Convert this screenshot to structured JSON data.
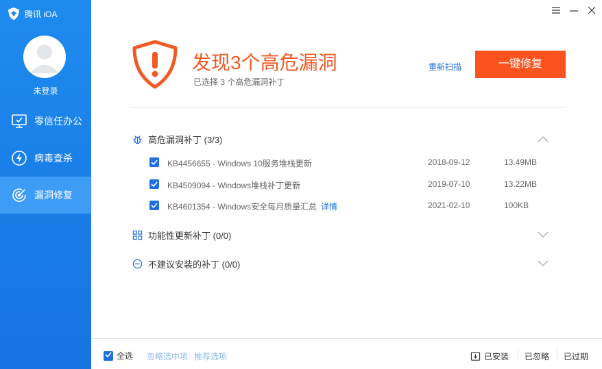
{
  "app": {
    "title": "腾讯 iOA"
  },
  "user": {
    "name": "未登录"
  },
  "sidebar": {
    "items": [
      {
        "label": "零信任办公",
        "icon": "monitor-check-icon",
        "active": false
      },
      {
        "label": "病毒查杀",
        "icon": "lightning-icon",
        "active": false
      },
      {
        "label": "漏洞修复",
        "icon": "radar-icon",
        "active": true
      }
    ]
  },
  "header": {
    "headline": "发现3个高危漏洞",
    "subline": "已选择 3 个高危漏洞补丁",
    "rescan_label": "重新扫描",
    "fix_label": "一键修复"
  },
  "groups": [
    {
      "label": "高危漏洞补丁 (3/3)",
      "icon": "bug-icon",
      "expanded": true,
      "patches": [
        {
          "name": "KB4456655 - Windows 10服务堆栈更新",
          "detail": "",
          "date": "2018-09-12",
          "size": "13.49MB",
          "checked": true
        },
        {
          "name": "KB4509094 - Windows堆栈补丁更新",
          "detail": "",
          "date": "2019-07-10",
          "size": "13.22MB",
          "checked": true
        },
        {
          "name": "KB4601354 - Windows安全每月质量汇总",
          "detail": "详情",
          "date": "2021-02-10",
          "size": "100KB",
          "checked": true
        }
      ]
    },
    {
      "label": "功能性更新补丁 (0/0)",
      "icon": "grid-icon",
      "expanded": false
    },
    {
      "label": "不建议安装的补丁 (0/0)",
      "icon": "minus-circle-icon",
      "expanded": false
    }
  ],
  "footer": {
    "select_all_label": "全选",
    "ignore_selected_label": "忽略选中项",
    "recommended_label": "推荐选项",
    "installed_label": "已安装",
    "ignored_label": "已忽略",
    "expired_label": "已过期"
  },
  "colors": {
    "sidebar": "#1e8bf0",
    "sidebar_active": "#3d9cf5",
    "accent_orange": "#fb5320",
    "headline": "#f15a24",
    "link_blue": "#1e6fe0"
  }
}
